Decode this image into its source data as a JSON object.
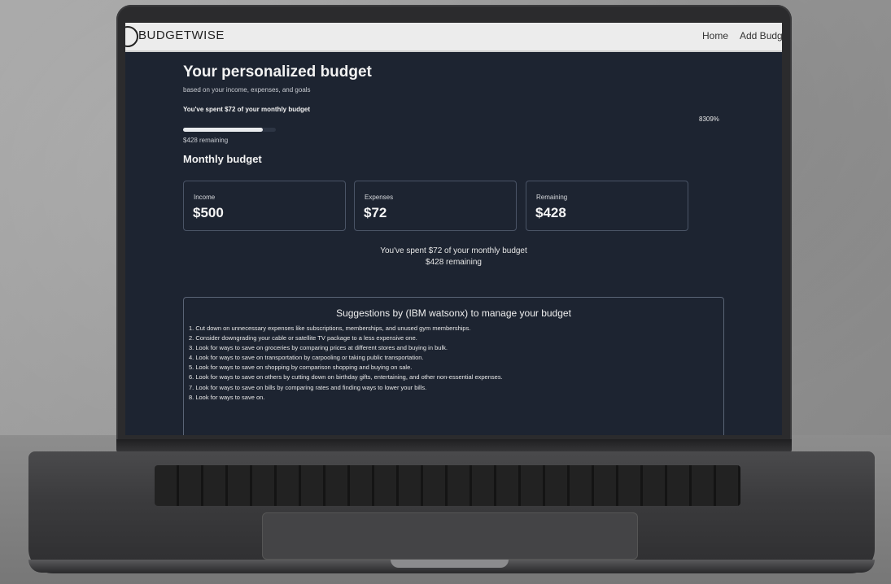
{
  "app": {
    "brand": "BUDGETWISE"
  },
  "nav": {
    "home": "Home",
    "add_budget": "Add Budg"
  },
  "header": {
    "title": "Your personalized budget",
    "subtitle": "based on your income, expenses, and goals",
    "spent_summary": "You've spent $72 of your monthly budget",
    "percent_text": "8309%",
    "progress_fraction": 0.86,
    "remaining": "$428 remaining"
  },
  "monthly": {
    "title": "Monthly budget",
    "cards": [
      {
        "label": "Income",
        "value": "$500"
      },
      {
        "label": "Expenses",
        "value": "$72"
      },
      {
        "label": "Remaining",
        "value": "$428"
      }
    ],
    "summary_line1": "You've spent $72 of your monthly budget",
    "summary_line2": "$428 remaining"
  },
  "suggestions": {
    "title": "Suggestions by (IBM watsonx) to manage your budget",
    "items": [
      "1. Cut down on unnecessary expenses like subscriptions, memberships, and unused gym memberships.",
      "2. Consider downgrading your cable or satellite TV package to a less expensive one.",
      "3. Look for ways to save on groceries by comparing prices at different stores and buying in bulk.",
      "4. Look for ways to save on transportation by carpooling or taking public transportation.",
      "5. Look for ways to save on shopping by comparison shopping and buying on sale.",
      "6. Look for ways to save on others by cutting down on birthday gifts, entertaining, and other non-essential expenses.",
      "7. Look for ways to save on bills by comparing rates and finding ways to lower your bills.",
      "8. Look for ways to save on."
    ]
  },
  "colors": {
    "screen_bg": "#1d2431",
    "navbar_bg": "#ececec",
    "card_border": "#4a5466",
    "progress_fill": "#e9ebee"
  }
}
